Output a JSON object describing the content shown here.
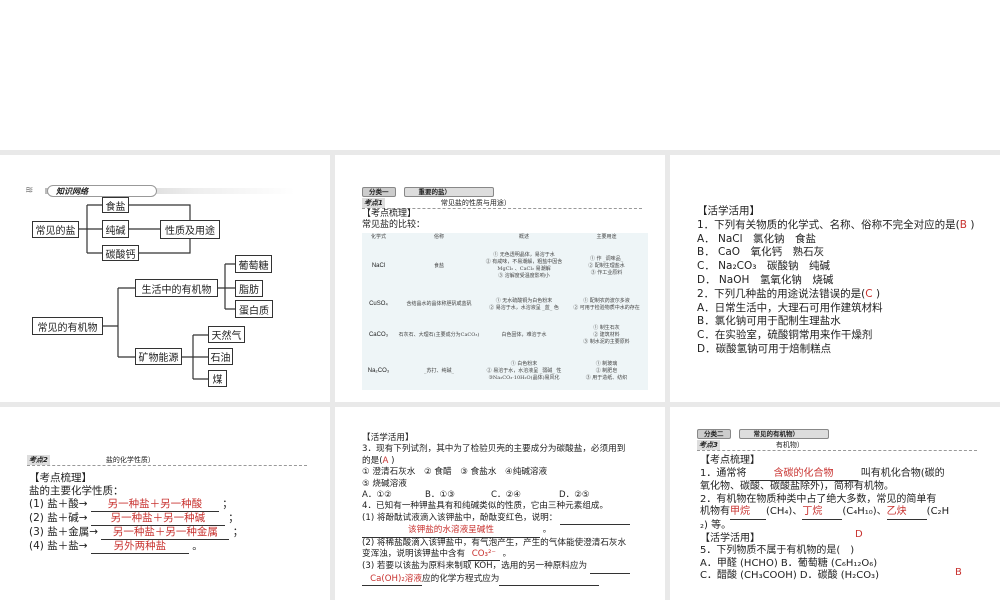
{
  "slide1": {
    "banner": "知识网络",
    "salt_root": "常见的盐",
    "salt_items": [
      "食盐",
      "纯碱",
      "碳酸钙"
    ],
    "salt_prop": "性质及用途",
    "org_root": "常见的有机物",
    "org_life": "生活中的有机物",
    "org_life_items": [
      "葡萄糖",
      "脂肪",
      "蛋白质"
    ],
    "org_energy": "矿物能源",
    "org_energy_items": [
      "天然气",
      "石油",
      "煤"
    ]
  },
  "slide2": {
    "cat_label": "分类一",
    "cat_title": "重要的盐）",
    "kd_label": "考点1",
    "kd_title": "常见盐的性质与用途）",
    "section": "【考点梳理】",
    "intro": "常见盐的比较：",
    "headers": [
      "化学式",
      "俗称",
      "概述",
      "主要用途"
    ],
    "rows": [
      {
        "formula": "NaCl",
        "name": "食盐",
        "desc": [
          "① 无色透明晶体，易溶于水",
          "② 有咸味，不易潮解，粗盐中因含 MgCl₂ 、CaCl₂ 易潮解",
          "③ 溶解度受温度影响小"
        ],
        "use": [
          "① 作 _调味品_",
          "② 配制生理盐水",
          "③ 作工业原料"
        ]
      },
      {
        "formula": "CuSO₄",
        "name": "含结晶水的晶体称胆矾或蓝矾",
        "desc": [
          "① 无水硫酸铜为白色粉末",
          "② 易溶于水，水溶液呈 _蓝_ 色"
        ],
        "use": [
          "① 配制农药波尔多液",
          "② 可用于检验物质中水的存在"
        ]
      },
      {
        "formula": "CaCO₃",
        "name": "石灰石、大理石(主要成分为CaCO₃)",
        "desc": [
          "白色固体，难溶于水"
        ],
        "use": [
          "① 制生石灰",
          "② 建筑材料",
          "③ 制水泥的主要原料"
        ]
      },
      {
        "formula": "Na₂CO₃",
        "name": "_苏打、纯碱_",
        "desc": [
          "① 白色粉末",
          "② 易溶于水，水溶液呈 _弱碱_ 性",
          "③Na₂CO₃·10H₂O(晶体)易风化"
        ],
        "use": [
          "① 制玻璃",
          "② 制肥皂",
          "③ 用于造纸、纺织"
        ]
      }
    ]
  },
  "slide3": {
    "section": "【活学活用】",
    "q1": "1．下列有关物质的化学式、名称、俗称不完全对应的是(",
    "q1_answer": "B",
    "q1_end": " )",
    "q1_opts": [
      "A． NaCl　氯化钠　食盐",
      "B． CaO　氧化钙　熟石灰",
      "C． Na₂CO₃　碳酸钠　纯碱",
      "D． NaOH　氢氧化钠　烧碱"
    ],
    "q2": "2．下列几种盐的用途说法错误的是(",
    "q2_answer": "C",
    "q2_end": " )",
    "q2_opts": [
      "A．日常生活中，大理石可用作建筑材料",
      "B．氯化钠可用于配制生理盐水",
      "C．在实验室，硫酸铜常用来作干燥剂",
      "D．碳酸氢钠可用于焙制糕点"
    ]
  },
  "slide4": {
    "kd_label": "考点2",
    "kd_title": "盐的化学性质）",
    "section": "【考点梳理】",
    "intro": "盐的主要化学性质：",
    "items": [
      {
        "lhs": "(1) 盐＋酸→",
        "ans": "另一种盐＋另一种酸",
        "end": "；"
      },
      {
        "lhs": "(2) 盐＋碱→",
        "ans": "另一种盐＋另一种碱",
        "end": "；"
      },
      {
        "lhs": "(3) 盐＋金属→",
        "ans": "另一种盐＋另一种金属",
        "end": "；"
      },
      {
        "lhs": "(4) 盐＋盐→",
        "ans": "另外两种盐",
        "end": "。"
      }
    ]
  },
  "slide5": {
    "section": "【活学活用】",
    "q3a": "3．现有下列试剂，其中为了检验贝壳的主要成分为碳酸盐，必须用到",
    "q3b": "的是(",
    "q3_answer": "A",
    "q3_end": " )",
    "q3_list1": "① 澄清石灰水　② 食醋　③ 食盐水　④纯碱溶液",
    "q3_list2": "⑤ 烧碱溶液",
    "q3_opts": [
      "A．①②",
      "B．①③",
      "C．②④",
      "D．②⑤"
    ],
    "q4": "4．已知有一种钾盐具有和纯碱类似的性质，它由三种元素组成。",
    "q4_1": "(1) 将酚酞试液滴入该钾盐中，酚酞变红色，说明：",
    "q4_1_ans": "该钾盐的水溶液呈碱性",
    "q4_2a": "(2) 将稀盐酸滴入该钾盐中，有气泡产生，产生的气体能使澄清石灰水",
    "q4_2b": "变浑浊，说明该钾盐中含有",
    "q4_2_ans": "CO₃²⁻",
    "q4_3": "(3) 若要以该盐为原料来制取 KOH，选用的另一种原料应为",
    "q4_3_ans": "Ca(OH)₂溶液",
    "q4_3b": "应的化学方程式应为"
  },
  "slide6": {
    "cat_label": "分类二",
    "cat_title": "常见的有机物）",
    "kd_label": "考点3",
    "kd_title": "有机物）",
    "section": "【考点梳理】",
    "p1a": "1．通常将",
    "p1_ans": "含碳的化合物",
    "p1b": "叫有机化合物(碳的",
    "p1c": "氧化物、碳酸、碳酸盐除外)，简称有机物。",
    "p2a": "2．有机物在物质种类中占了绝大多数，常见的简单有",
    "p2b": "机物有",
    "ans_ch4": "甲烷",
    "f_ch4": "(CH₄)、",
    "ans_c4h10": "丁烷",
    "f_c4h10": "(C₄H₁₀)、",
    "ans_c2h2": "乙炔",
    "f_c2h2": "(C₂H",
    "p2c": "₂) 等。",
    "section2": "【活学活用】",
    "q5": "5．下列物质不属于有机物的是(　)",
    "q5_answer": "D",
    "q5_a": "A．甲醛 (HCHO)  B．葡萄糖 (C₆H₁₂O₆)",
    "q5_c": "C．醋酸 (CH₃COOH)  D．碳酸 (H₂CO₃)",
    "q6_answer": "B"
  }
}
